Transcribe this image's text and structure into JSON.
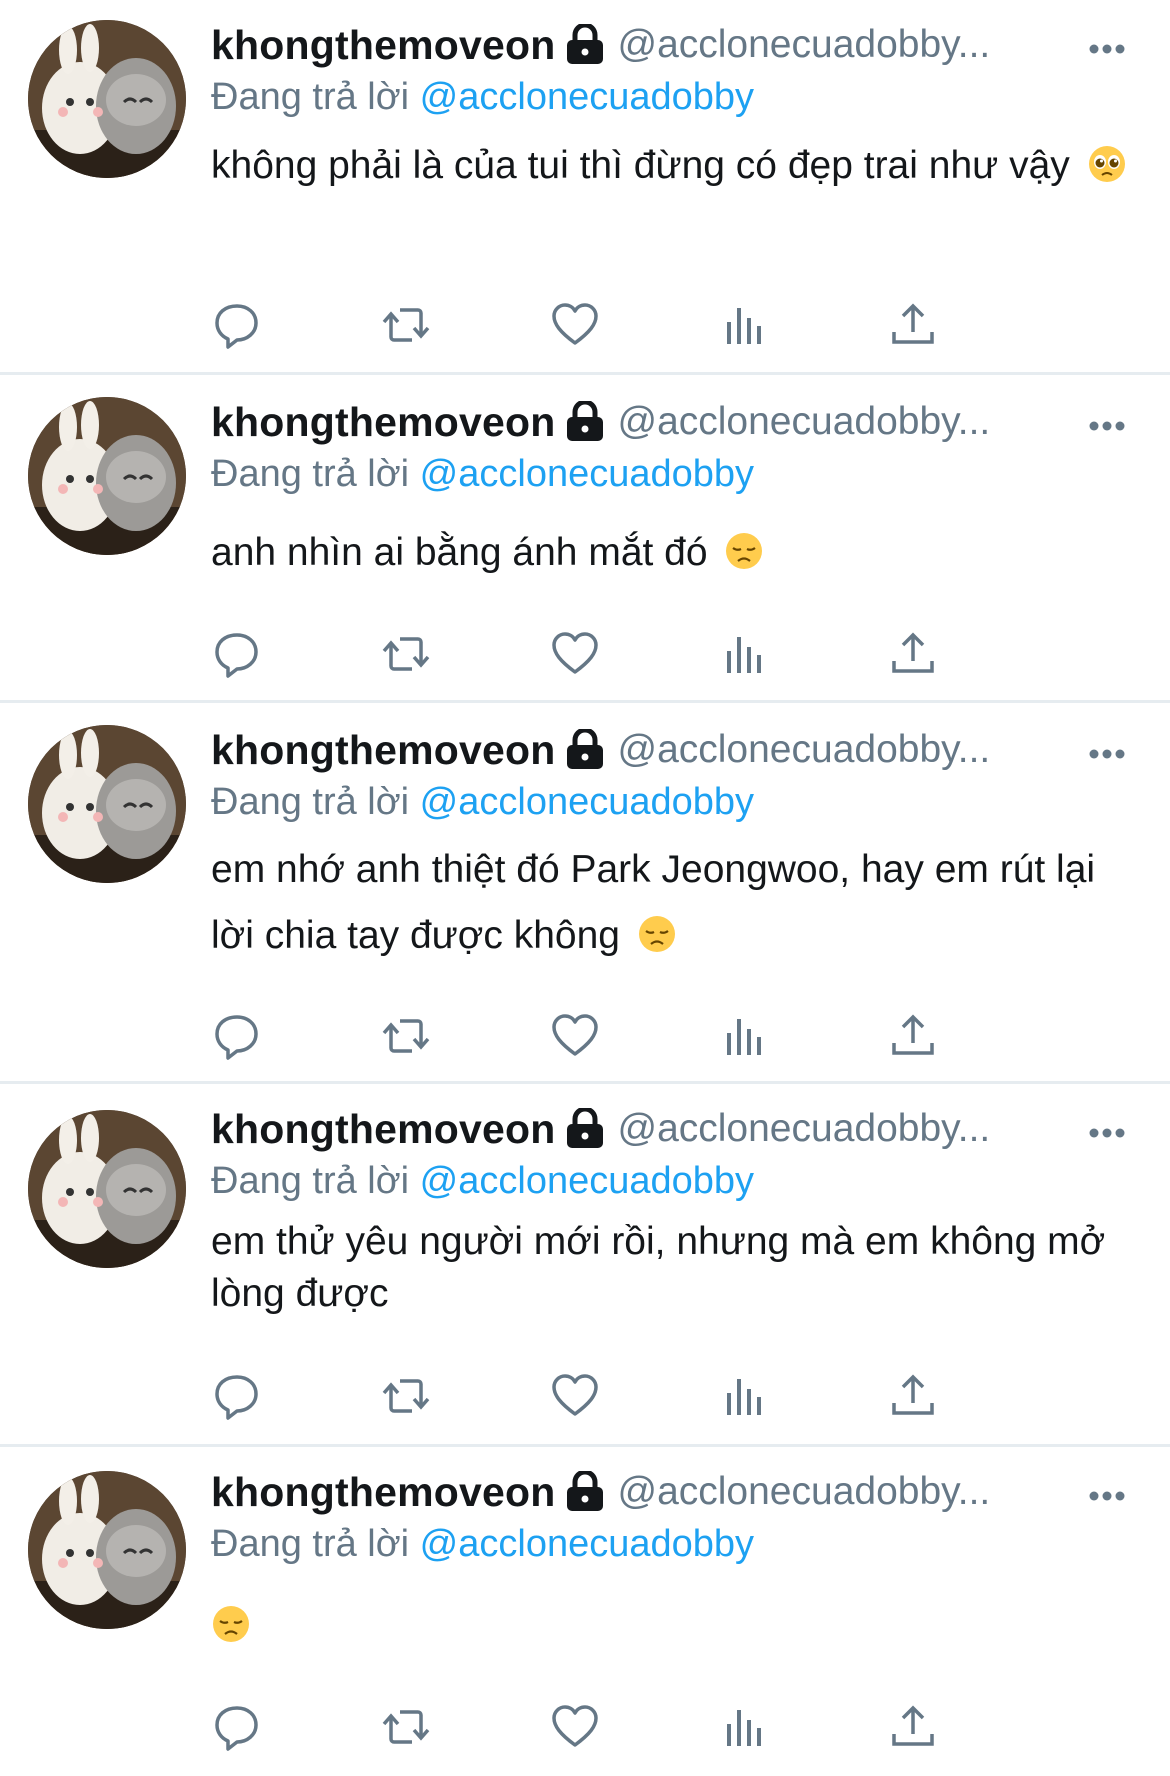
{
  "tweets": [
    {
      "display_name": "khongthemoveon",
      "handle": "@acclonecuadobby...",
      "reply_prefix": "Đang trả lời",
      "reply_to": "@acclonecuadobby",
      "text": "không phải là của tui thì đừng có đẹp trai như vậy",
      "emoji": "pleading-face"
    },
    {
      "display_name": "khongthemoveon",
      "handle": "@acclonecuadobby...",
      "reply_prefix": "Đang trả lời",
      "reply_to": "@acclonecuadobby",
      "text": "anh nhìn ai bằng ánh mắt đó",
      "emoji": "disappointed-face"
    },
    {
      "display_name": "khongthemoveon",
      "handle": "@acclonecuadobby...",
      "reply_prefix": "Đang trả lời",
      "reply_to": "@acclonecuadobby",
      "text": "em nhớ anh thiệt đó Park Jeongwoo, hay em rút lại lời chia tay được không",
      "emoji": "disappointed-face"
    },
    {
      "display_name": "khongthemoveon",
      "handle": "@acclonecuadobby...",
      "reply_prefix": "Đang trả lời",
      "reply_to": "@acclonecuadobby",
      "text": "em thử yêu người mới rồi, nhưng mà em không mở lòng được",
      "emoji": ""
    },
    {
      "display_name": "khongthemoveon",
      "handle": "@acclonecuadobby...",
      "reply_prefix": "Đang trả lời",
      "reply_to": "@acclonecuadobby",
      "text": "",
      "emoji": "disappointed-face"
    }
  ],
  "action_icons": [
    "reply-icon",
    "retweet-icon",
    "like-icon",
    "analytics-icon",
    "share-icon"
  ],
  "colors": {
    "text": "#14171a",
    "secondary": "#657786",
    "link": "#1da1f2",
    "divider": "#e6ecf0"
  }
}
